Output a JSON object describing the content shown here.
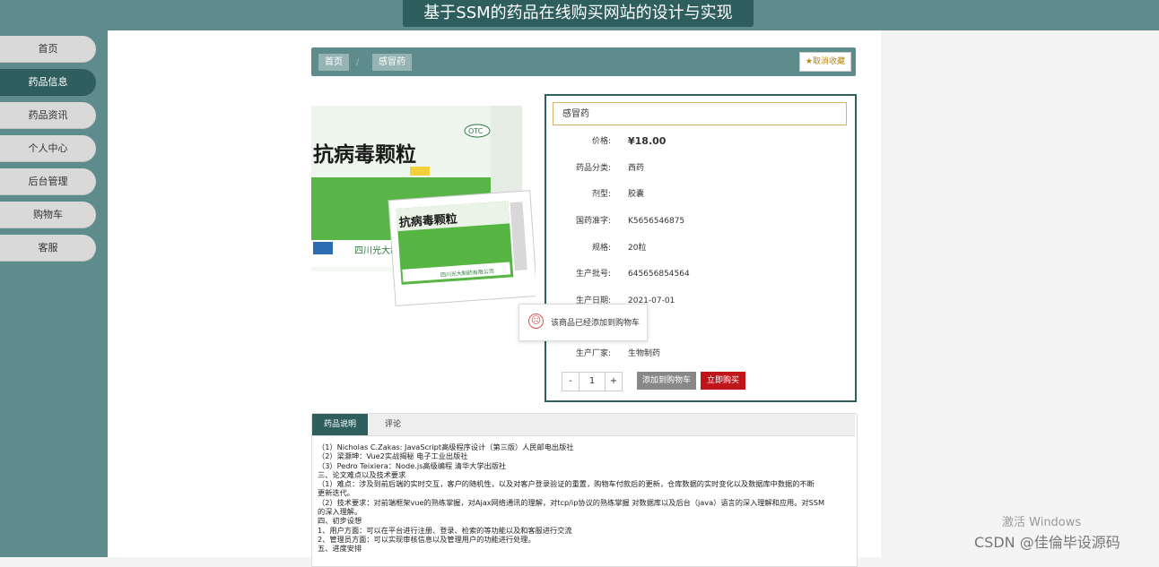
{
  "app": {
    "title": "基于SSM的药品在线购买网站的设计与实现"
  },
  "sidebar": {
    "items": [
      {
        "label": "首页"
      },
      {
        "label": "药品信息"
      },
      {
        "label": "药品资讯"
      },
      {
        "label": "个人中心"
      },
      {
        "label": "后台管理"
      },
      {
        "label": "购物车"
      },
      {
        "label": "客服"
      }
    ]
  },
  "breadcrumb": {
    "home": "首页",
    "current": "感冒药",
    "favorite": "★取消收藏"
  },
  "product": {
    "name": "感冒药",
    "price_label": "价格:",
    "price": "¥18.00",
    "fields": [
      {
        "label": "药品分类:",
        "value": "西药"
      },
      {
        "label": "剂型:",
        "value": "胶囊"
      },
      {
        "label": "国药准字:",
        "value": "K5656546875"
      },
      {
        "label": "规格:",
        "value": "20粒"
      },
      {
        "label": "生产批号:",
        "value": "645656854564"
      },
      {
        "label": "生产日期:",
        "value": "2021-07-01"
      },
      {
        "label": "生产厂家:",
        "value": "生物制药"
      }
    ],
    "quantity": "1",
    "minus": "-",
    "plus": "+",
    "add_cart_label": "添加到购物车",
    "buy_now_label": "立即购买",
    "image": {
      "box_title": "抗病毒颗粒",
      "packet_title": "抗病毒颗粒",
      "badge": "OTC",
      "maker": "四川光大制",
      "packet_maker": "四川光大制药有限公司"
    }
  },
  "toast": {
    "message": "该商品已经添加到购物车"
  },
  "tabs": [
    {
      "label": "药品说明"
    },
    {
      "label": "评论"
    }
  ],
  "description": [
    "（1）Nicholas C.Zakas: JavaScript高级程序设计（第三版）人民邮电出版社",
    "（2）梁灏坤：Vue2实战揭秘 电子工业出版社",
    "（3）Pedro Teixiera：Node.js高级编程 清华大学出版社",
    "三、论文难点以及技术要求",
    "（1）难点：涉及到前后端的实时交互，客户的随机性，以及对客户登录验证的重置，购物车付款后的更新，仓库数据的实时变化以及数据库中数据的不断",
    "更新迭代。",
    "（2）技术要求：对前端框架vue的熟练掌握，对Ajax网络通讯的理解，对tcp/ip协议的熟练掌握 对数据库以及后台（java）语言的深入理解和应用。对SSM",
    "的深入理解。",
    "四、初步设想",
    "1、用户方面：可以在平台进行注册、登录、检索的等功能以及和客服进行交流",
    "2、管理员方面：可以实现审核信息以及管理用户的功能进行处理。",
    "五、进度安排"
  ],
  "overlay": {
    "activate_windows": "激活 Windows",
    "csdn": "CSDN @佳倫毕设源码"
  },
  "colors": {
    "theme": "#5e8c8c",
    "theme_dark": "#2f5e5e",
    "price": "#c8961e",
    "buy": "#c0161b"
  }
}
